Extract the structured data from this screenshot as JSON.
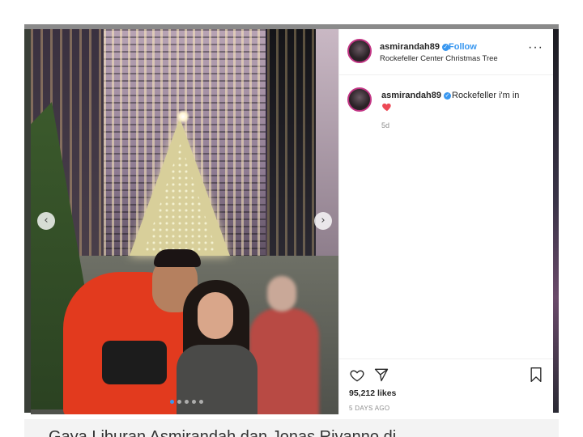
{
  "post": {
    "username": "asmirandah89",
    "follow_separator": "•",
    "follow_label": "Follow",
    "location": "Rockefeller Center Christmas Tree",
    "more_label": "···",
    "verified_glyph": "✓"
  },
  "comment": {
    "username": "asmirandah89",
    "text": "Rockefeller i'm in",
    "emoji_icon": "red-heart-icon",
    "time_ago": "5d"
  },
  "actions": {
    "likes_text": "95,212 likes",
    "posted_text": "5 DAYS AGO",
    "icons": [
      "like-heart-icon",
      "share-send-icon",
      "bookmark-icon"
    ]
  },
  "carousel": {
    "prev_glyph": "‹",
    "next_glyph": "›",
    "dots_count": 5,
    "active_dot": 0
  },
  "article": {
    "caption_partial": "Gaya Liburan Asmirandah dan Jonas Rivanno di"
  },
  "colors": {
    "accent_blue": "#3897f0",
    "heart_red": "#ed4956",
    "text_dark": "#262626",
    "text_muted": "#8e8e8e"
  }
}
